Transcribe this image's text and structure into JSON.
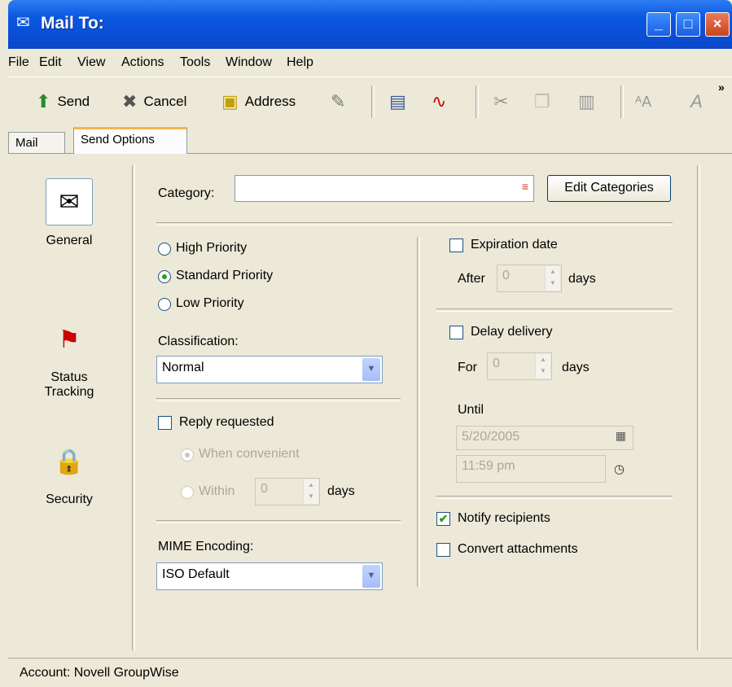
{
  "window": {
    "title": "Mail To:",
    "icon": "mail-window-icon"
  },
  "title_buttons": {
    "minimize": "_",
    "maximize": "□",
    "close": "×"
  },
  "menu": [
    "File",
    "Edit",
    "View",
    "Actions",
    "Tools",
    "Window",
    "Help"
  ],
  "toolbar": {
    "send": "Send",
    "cancel": "Cancel",
    "address": "Address",
    "overflow": "»"
  },
  "tabs": {
    "mail": "Mail",
    "send_options": "Send Options"
  },
  "sidebar": {
    "general": "General",
    "status_tracking_1": "Status",
    "status_tracking_2": "Tracking",
    "security": "Security"
  },
  "category": {
    "label": "Category:",
    "value": "",
    "button": "Edit Categories"
  },
  "priority": {
    "high": "High Priority",
    "standard": "Standard Priority",
    "low": "Low Priority",
    "selected": "standard"
  },
  "classification": {
    "label": "Classification:",
    "value": "Normal"
  },
  "reply": {
    "label": "Reply requested",
    "when": "When convenient",
    "within": "Within",
    "within_value": "0",
    "days": "days"
  },
  "mime": {
    "label": "MIME Encoding:",
    "value": "ISO Default"
  },
  "expiration": {
    "label": "Expiration date",
    "after": "After",
    "value": "0",
    "days": "days"
  },
  "delay": {
    "label": "Delay delivery",
    "for": "For",
    "value": "0",
    "days": "days",
    "until": "Until",
    "date": "5/20/2005",
    "time": "11:59 pm"
  },
  "notify": {
    "label": "Notify recipients",
    "checked": true
  },
  "convert": {
    "label": "Convert attachments",
    "checked": false
  },
  "status": {
    "account": "Account: Novell GroupWise"
  },
  "colors": {
    "titlebar": "#0a57e0",
    "accent_tab": "#f7b44a",
    "check": "#21a121"
  }
}
